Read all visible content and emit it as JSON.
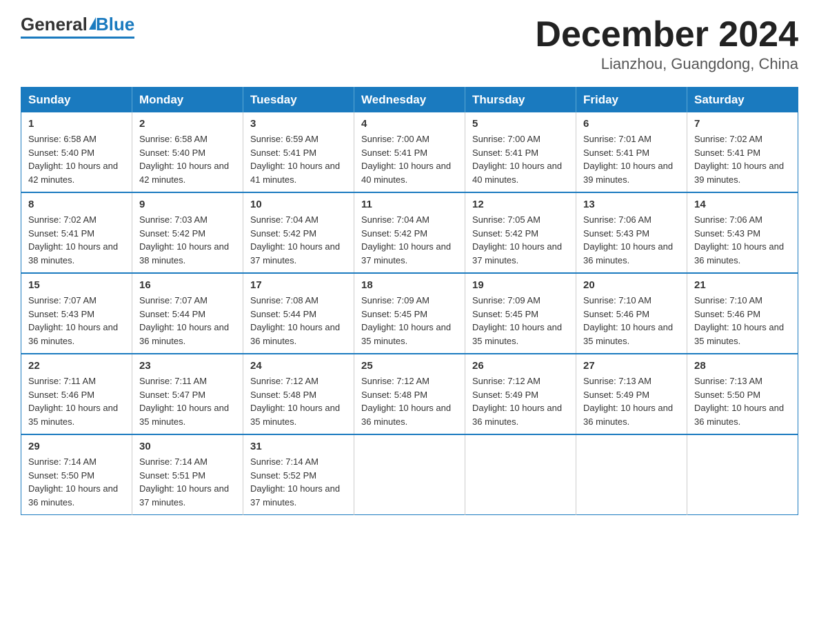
{
  "logo": {
    "general": "General",
    "blue": "Blue"
  },
  "header": {
    "title": "December 2024",
    "subtitle": "Lianzhou, Guangdong, China"
  },
  "days_of_week": [
    "Sunday",
    "Monday",
    "Tuesday",
    "Wednesday",
    "Thursday",
    "Friday",
    "Saturday"
  ],
  "weeks": [
    [
      {
        "day": "1",
        "sunrise": "6:58 AM",
        "sunset": "5:40 PM",
        "daylight": "10 hours and 42 minutes."
      },
      {
        "day": "2",
        "sunrise": "6:58 AM",
        "sunset": "5:40 PM",
        "daylight": "10 hours and 42 minutes."
      },
      {
        "day": "3",
        "sunrise": "6:59 AM",
        "sunset": "5:41 PM",
        "daylight": "10 hours and 41 minutes."
      },
      {
        "day": "4",
        "sunrise": "7:00 AM",
        "sunset": "5:41 PM",
        "daylight": "10 hours and 40 minutes."
      },
      {
        "day": "5",
        "sunrise": "7:00 AM",
        "sunset": "5:41 PM",
        "daylight": "10 hours and 40 minutes."
      },
      {
        "day": "6",
        "sunrise": "7:01 AM",
        "sunset": "5:41 PM",
        "daylight": "10 hours and 39 minutes."
      },
      {
        "day": "7",
        "sunrise": "7:02 AM",
        "sunset": "5:41 PM",
        "daylight": "10 hours and 39 minutes."
      }
    ],
    [
      {
        "day": "8",
        "sunrise": "7:02 AM",
        "sunset": "5:41 PM",
        "daylight": "10 hours and 38 minutes."
      },
      {
        "day": "9",
        "sunrise": "7:03 AM",
        "sunset": "5:42 PM",
        "daylight": "10 hours and 38 minutes."
      },
      {
        "day": "10",
        "sunrise": "7:04 AM",
        "sunset": "5:42 PM",
        "daylight": "10 hours and 37 minutes."
      },
      {
        "day": "11",
        "sunrise": "7:04 AM",
        "sunset": "5:42 PM",
        "daylight": "10 hours and 37 minutes."
      },
      {
        "day": "12",
        "sunrise": "7:05 AM",
        "sunset": "5:42 PM",
        "daylight": "10 hours and 37 minutes."
      },
      {
        "day": "13",
        "sunrise": "7:06 AM",
        "sunset": "5:43 PM",
        "daylight": "10 hours and 36 minutes."
      },
      {
        "day": "14",
        "sunrise": "7:06 AM",
        "sunset": "5:43 PM",
        "daylight": "10 hours and 36 minutes."
      }
    ],
    [
      {
        "day": "15",
        "sunrise": "7:07 AM",
        "sunset": "5:43 PM",
        "daylight": "10 hours and 36 minutes."
      },
      {
        "day": "16",
        "sunrise": "7:07 AM",
        "sunset": "5:44 PM",
        "daylight": "10 hours and 36 minutes."
      },
      {
        "day": "17",
        "sunrise": "7:08 AM",
        "sunset": "5:44 PM",
        "daylight": "10 hours and 36 minutes."
      },
      {
        "day": "18",
        "sunrise": "7:09 AM",
        "sunset": "5:45 PM",
        "daylight": "10 hours and 35 minutes."
      },
      {
        "day": "19",
        "sunrise": "7:09 AM",
        "sunset": "5:45 PM",
        "daylight": "10 hours and 35 minutes."
      },
      {
        "day": "20",
        "sunrise": "7:10 AM",
        "sunset": "5:46 PM",
        "daylight": "10 hours and 35 minutes."
      },
      {
        "day": "21",
        "sunrise": "7:10 AM",
        "sunset": "5:46 PM",
        "daylight": "10 hours and 35 minutes."
      }
    ],
    [
      {
        "day": "22",
        "sunrise": "7:11 AM",
        "sunset": "5:46 PM",
        "daylight": "10 hours and 35 minutes."
      },
      {
        "day": "23",
        "sunrise": "7:11 AM",
        "sunset": "5:47 PM",
        "daylight": "10 hours and 35 minutes."
      },
      {
        "day": "24",
        "sunrise": "7:12 AM",
        "sunset": "5:48 PM",
        "daylight": "10 hours and 35 minutes."
      },
      {
        "day": "25",
        "sunrise": "7:12 AM",
        "sunset": "5:48 PM",
        "daylight": "10 hours and 36 minutes."
      },
      {
        "day": "26",
        "sunrise": "7:12 AM",
        "sunset": "5:49 PM",
        "daylight": "10 hours and 36 minutes."
      },
      {
        "day": "27",
        "sunrise": "7:13 AM",
        "sunset": "5:49 PM",
        "daylight": "10 hours and 36 minutes."
      },
      {
        "day": "28",
        "sunrise": "7:13 AM",
        "sunset": "5:50 PM",
        "daylight": "10 hours and 36 minutes."
      }
    ],
    [
      {
        "day": "29",
        "sunrise": "7:14 AM",
        "sunset": "5:50 PM",
        "daylight": "10 hours and 36 minutes."
      },
      {
        "day": "30",
        "sunrise": "7:14 AM",
        "sunset": "5:51 PM",
        "daylight": "10 hours and 37 minutes."
      },
      {
        "day": "31",
        "sunrise": "7:14 AM",
        "sunset": "5:52 PM",
        "daylight": "10 hours and 37 minutes."
      },
      null,
      null,
      null,
      null
    ]
  ]
}
